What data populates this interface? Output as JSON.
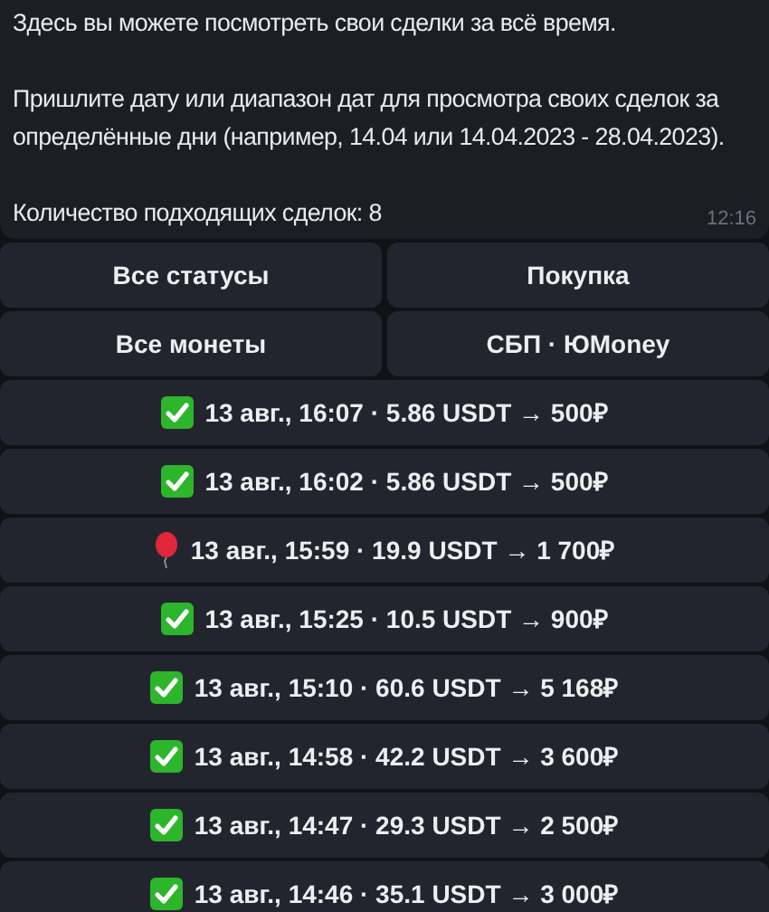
{
  "message": {
    "paragraphs": [
      "Здесь вы можете посмотреть свои сделки за всё время.",
      "Пришлите дату или диапазон дат для просмотра своих сделок за определённые дни (например, 14.04 или 14.04.2023 - 28.04.2023).",
      "Количество подходящих сделок: 8"
    ],
    "time": "12:16"
  },
  "filter_buttons": [
    [
      "Все статусы",
      "Покупка"
    ],
    [
      "Все монеты",
      "СБП · ЮMoney"
    ]
  ],
  "deals": [
    {
      "kind": "done",
      "label": "13 авг., 16:07 · 5.86 USDT → 500₽"
    },
    {
      "kind": "done",
      "label": "13 авг., 16:02 · 5.86 USDT → 500₽"
    },
    {
      "kind": "balloon",
      "label": "13 авг., 15:59 · 19.9 USDT → 1 700₽"
    },
    {
      "kind": "done",
      "label": "13 авг., 15:25 · 10.5 USDT → 900₽"
    },
    {
      "kind": "done",
      "label": "13 авг., 15:10 · 60.6 USDT → 5 168₽"
    },
    {
      "kind": "done",
      "label": "13 авг., 14:58 · 42.2 USDT → 3 600₽"
    },
    {
      "kind": "done",
      "label": "13 авг., 14:47 · 29.3 USDT → 2 500₽"
    },
    {
      "kind": "done",
      "label": "13 авг., 14:46 · 35.1 USDT → 3 000₽"
    }
  ]
}
